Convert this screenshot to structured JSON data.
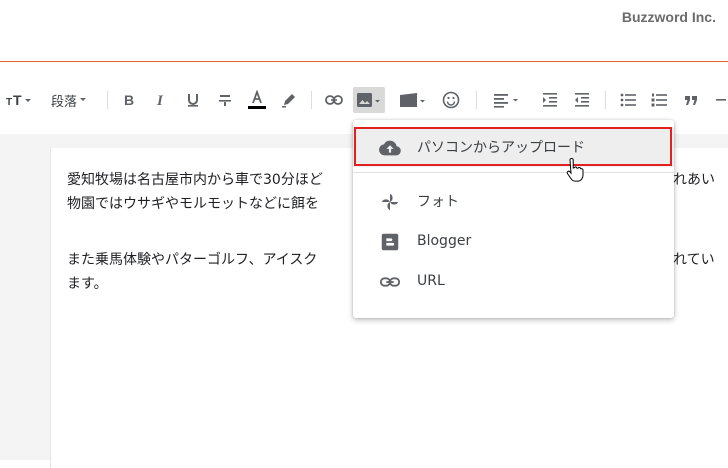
{
  "brand": "Buzzword Inc.",
  "toolbar": {
    "paragraph_label": "段落",
    "items": [
      "font-size-icon",
      "bold-icon",
      "italic-icon",
      "underline-icon",
      "strikethrough-icon",
      "text-color-icon",
      "highlight-icon",
      "link-icon",
      "image-icon",
      "video-icon",
      "emoji-icon",
      "align-icon",
      "indent-icon",
      "outdent-icon",
      "bulleted-list-icon",
      "numbered-list-icon",
      "quote-icon"
    ],
    "text_color": "#000000"
  },
  "editor": {
    "line1": " 愛知牧場は名古屋市内から車で30分ほど",
    "line1_tail": "ふれあい",
    "line2": "物園ではウサギやモルモットなどに餌を",
    "line3": "また乗馬体験やパターゴルフ、アイスク",
    "line3_tail": "されてい",
    "line4": "ます。"
  },
  "image_menu": {
    "items": [
      {
        "label": "パソコンからアップロード",
        "icon": "cloud-upload-icon"
      },
      {
        "label": "フォト",
        "icon": "google-photos-icon"
      },
      {
        "label": "Blogger",
        "icon": "blogger-icon"
      },
      {
        "label": "URL",
        "icon": "link-icon"
      }
    ]
  },
  "colors": {
    "accent_line": "#e8622c",
    "highlight_box": "#e0211f"
  }
}
